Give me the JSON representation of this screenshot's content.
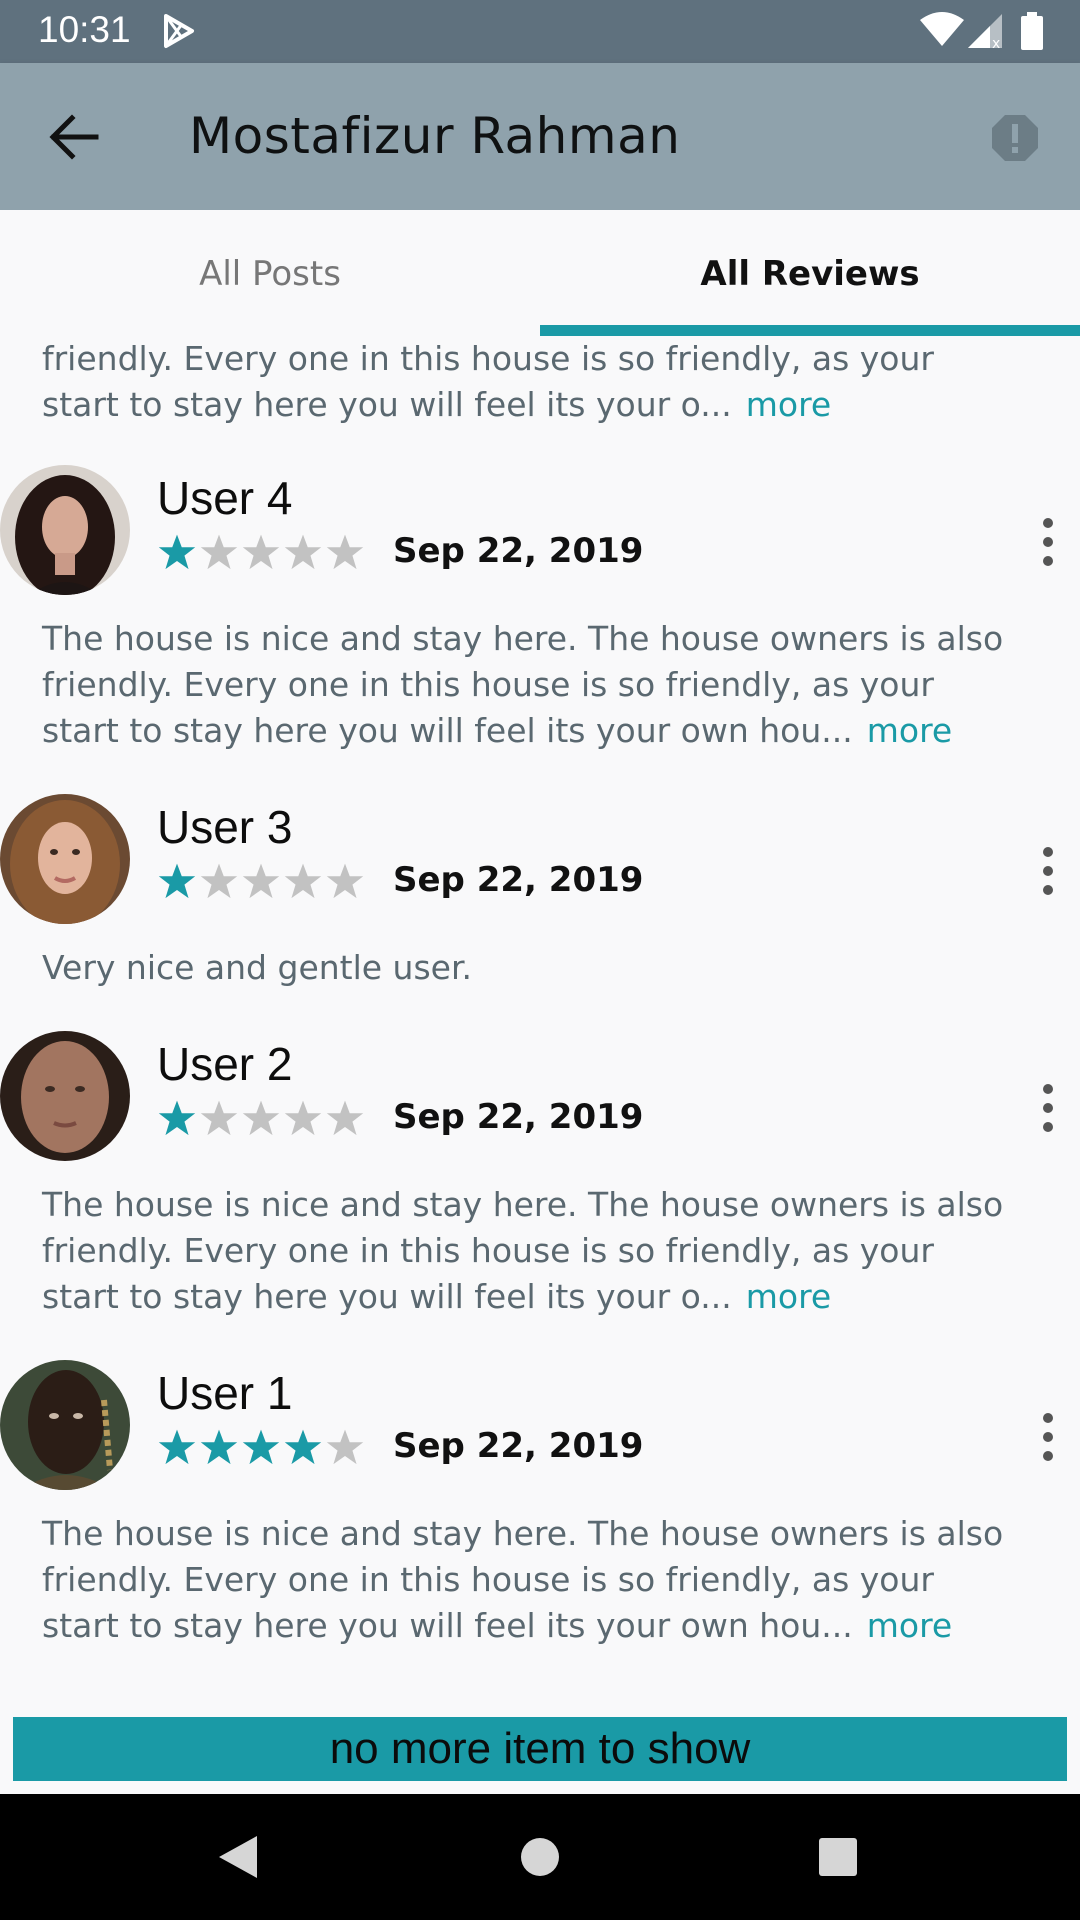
{
  "status_bar": {
    "time": "10:31",
    "icons": [
      "play-store-icon",
      "wifi-icon",
      "signal-icon",
      "battery-icon"
    ]
  },
  "app_bar": {
    "title": "Mostafizur Rahman",
    "back_icon": "arrow-left-icon",
    "report_icon": "report-icon"
  },
  "tabs": {
    "items": [
      {
        "label": "All Posts",
        "selected": false
      },
      {
        "label": "All Reviews",
        "selected": true
      }
    ]
  },
  "partial_review": {
    "lines": [
      "friendly. Every one in this house is so friendly, as your",
      "start to stay here you will feel its your o..."
    ],
    "more": "more"
  },
  "reviews": [
    {
      "user": "User 4",
      "rating": 1,
      "max_rating": 5,
      "date": "Sep 22, 2019",
      "lines": [
        "The house is nice and stay here. The house owners is also",
        "friendly. Every one in this house is so friendly, as your",
        "start to stay here you will feel its your own hou..."
      ],
      "more": "more"
    },
    {
      "user": "User 3",
      "rating": 1,
      "max_rating": 5,
      "date": "Sep 22, 2019",
      "lines": [
        "Very nice and gentle user."
      ],
      "more": ""
    },
    {
      "user": "User 2",
      "rating": 1,
      "max_rating": 5,
      "date": "Sep 22, 2019",
      "lines": [
        "The house is nice and stay here. The house owners is also",
        "friendly. Every one in this house is so friendly, as your",
        "start to stay here you will feel its your o..."
      ],
      "more": "more"
    },
    {
      "user": "User 1",
      "rating": 4,
      "max_rating": 5,
      "date": "Sep 22, 2019",
      "lines": [
        "The house is nice and stay here. The house owners is also",
        "friendly. Every one in this house is so friendly, as your",
        "start to stay here you will feel its your own hou..."
      ],
      "more": "more"
    }
  ],
  "footer": {
    "message": "no more item to show"
  },
  "colors": {
    "accent": "#1a9aa6",
    "status_bar": "#5f717e",
    "app_bar": "#8fa2ac",
    "star_empty": "#c2c2c2"
  }
}
